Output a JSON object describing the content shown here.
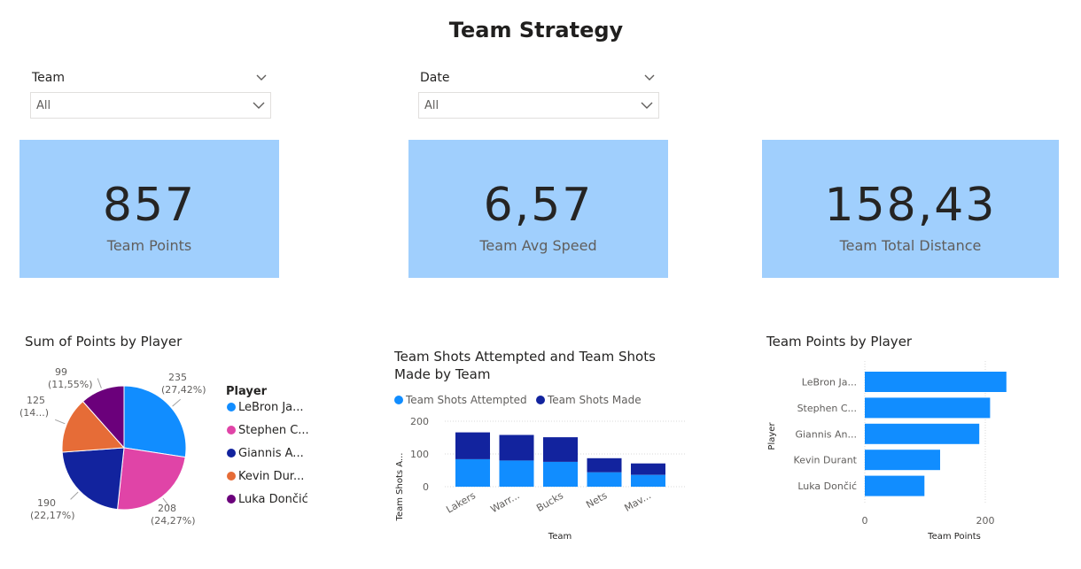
{
  "page": {
    "title": "Team Strategy"
  },
  "slicers": [
    {
      "label": "Team",
      "value": "All"
    },
    {
      "label": "Date",
      "value": "All"
    }
  ],
  "cards": [
    {
      "value": "857",
      "label": "Team Points"
    },
    {
      "value": "6,57",
      "label": "Team Avg Speed"
    },
    {
      "value": "158,43",
      "label": "Team Total Distance"
    }
  ],
  "colors": {
    "card_bg": "#a0cffd",
    "lebron": "#118dff",
    "stephen": "#e044a7",
    "giannis": "#12239e",
    "kevin": "#e66c37",
    "luka": "#6b007b"
  },
  "chart_data": [
    {
      "type": "pie",
      "title": "Sum of Points by Player",
      "legend_title": "Player",
      "legend_position": "right",
      "slices": [
        {
          "label": "LeBron Ja...",
          "value": 235,
          "pct": "27,42%",
          "data_label": "235",
          "data_label_2": "(27,42%)",
          "color": "#118dff"
        },
        {
          "label": "Stephen C...",
          "value": 208,
          "pct": "24,27%",
          "data_label": "208",
          "data_label_2": "(24,27%)",
          "color": "#e044a7"
        },
        {
          "label": "Giannis A...",
          "value": 190,
          "pct": "22,17%",
          "data_label": "190",
          "data_label_2": "(22,17%)",
          "color": "#12239e"
        },
        {
          "label": "Kevin Dur...",
          "value": 125,
          "pct": "14...",
          "data_label": "125",
          "data_label_2": "(14...)",
          "color": "#e66c37"
        },
        {
          "label": "Luka Dončić",
          "value": 99,
          "pct": "11,55%",
          "data_label": "99",
          "data_label_2": "(11,55%)",
          "color": "#6b007b"
        }
      ]
    },
    {
      "type": "bar",
      "stacked": true,
      "title_line1": "Team Shots Attempted and Team Shots",
      "title_line2": "Made by Team",
      "categories": [
        "Lakers",
        "Warr...",
        "Bucks",
        "Nets",
        "Mav..."
      ],
      "series": [
        {
          "name": "Team Shots Attempted",
          "values": [
            84,
            80,
            76,
            44,
            36
          ],
          "color": "#118dff"
        },
        {
          "name": "Team Shots Made",
          "values": [
            82,
            78,
            75,
            43,
            35
          ],
          "color": "#12239e"
        }
      ],
      "xlabel": "Team",
      "ylabel": "Team Shots A...",
      "ylim": [
        0,
        200
      ],
      "yticks": [
        "0",
        "100",
        "200"
      ],
      "legend_position": "top-left",
      "grid": true
    },
    {
      "type": "bar",
      "orientation": "horizontal",
      "title": "Team Points by Player",
      "categories": [
        "LeBron Ja...",
        "Stephen C...",
        "Giannis An...",
        "Kevin Durant",
        "Luka Dončić"
      ],
      "values": [
        235,
        208,
        190,
        125,
        99
      ],
      "color": "#118dff",
      "xlabel": "Team Points",
      "ylabel": "Player",
      "xlim": [
        0,
        240
      ],
      "xticks": [
        "0",
        "200"
      ],
      "grid": true
    }
  ]
}
